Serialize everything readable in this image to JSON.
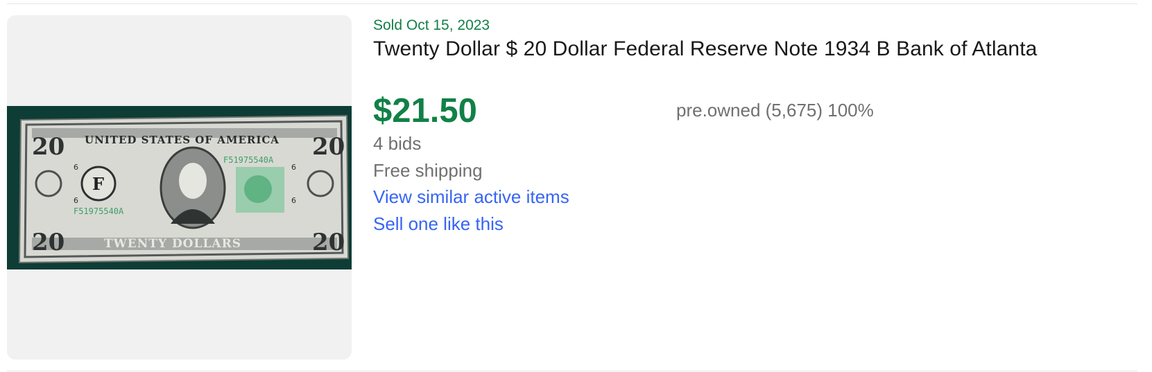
{
  "listing": {
    "sold_date": "Sold Oct 15, 2023",
    "title": "Twenty Dollar $ 20 Dollar Federal Reserve Note 1934 B Bank of Atlanta",
    "price": "$21.50",
    "seller_info": "pre.owned (5,675) 100%",
    "bids": "4 bids",
    "shipping": "Free shipping",
    "view_similar_label": "View similar active items",
    "sell_one_label": "Sell one like this",
    "image": {
      "denomination": "20",
      "top_text": "UNITED STATES OF AMERICA",
      "bottom_text": "TWENTY DOLLARS",
      "serial": "F51975540A",
      "district_letter": "F",
      "district_number": "6"
    }
  },
  "colors": {
    "sold_green": "#118146",
    "link_blue": "#3665f3",
    "muted_gray": "#707070",
    "title_black": "#191919",
    "image_bg": "#f1f1f1"
  }
}
